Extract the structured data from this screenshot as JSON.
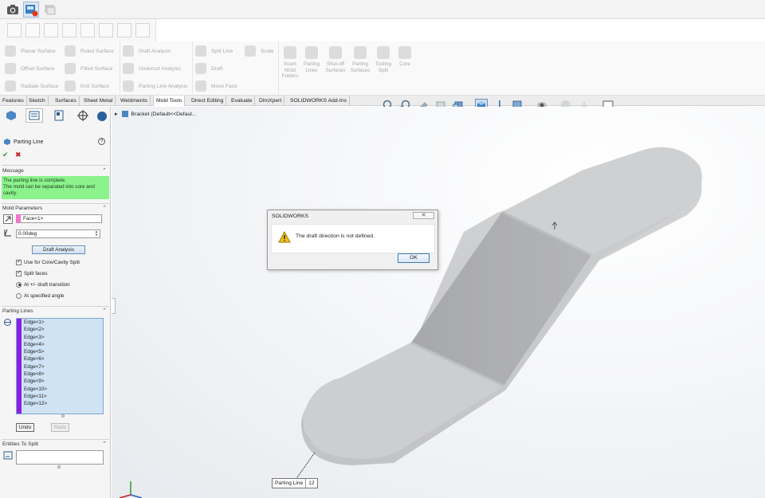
{
  "icons": {
    "top_strip": [
      "smart-dimension-icon",
      "capture-icon",
      "3d-sketch-icon"
    ],
    "sketch_row_count": 9
  },
  "ribbon": {
    "surface_tools": [
      {
        "label": "Planar Surface",
        "icon": "planar-surface-icon"
      },
      {
        "label": "Offset Surface",
        "icon": "offset-surface-icon"
      },
      {
        "label": "Radiate Surface",
        "icon": "radiate-surface-icon"
      },
      {
        "label": "Ruled Surface",
        "icon": "ruled-surface-icon"
      },
      {
        "label": "Filled Surface",
        "icon": "filled-surface-icon"
      },
      {
        "label": "Knit Surface",
        "icon": "knit-surface-icon"
      }
    ],
    "analysis_tools": [
      {
        "label": "Draft Analysis",
        "icon": "draft-analysis-icon"
      },
      {
        "label": "Undercut Analysis",
        "icon": "undercut-analysis-icon"
      },
      {
        "label": "Parting Line Analysis",
        "icon": "parting-line-analysis-icon"
      }
    ],
    "face_tools": [
      {
        "label": "Split Line",
        "icon": "split-line-icon"
      },
      {
        "label": "Draft",
        "icon": "draft-icon"
      },
      {
        "label": "Move Face",
        "icon": "move-face-icon"
      },
      {
        "label": "Scale",
        "icon": "scale-icon"
      }
    ],
    "big_tools": [
      {
        "label": "Insert Mold Folders",
        "icon": "insert-mold-folders-icon"
      },
      {
        "label": "Parting Lines",
        "icon": "parting-lines-icon"
      },
      {
        "label": "Shut-off Surfaces",
        "icon": "shut-off-surfaces-icon"
      },
      {
        "label": "Parting Surfaces",
        "icon": "parting-surfaces-icon"
      },
      {
        "label": "Tooling Split",
        "icon": "tooling-split-icon"
      },
      {
        "label": "Core",
        "icon": "core-icon"
      }
    ]
  },
  "tabs": [
    "Features",
    "Sketch",
    "Surfaces",
    "Sheet Metal",
    "Weldments",
    "Mold Tools",
    "Direct Editing",
    "Evaluate",
    "DimXpert",
    "SOLIDWORKS Add-Ins"
  ],
  "active_tab": "Mold Tools",
  "property_manager": {
    "title": "Parting Line",
    "message_section": "Message",
    "message_lines": [
      "The parting line is complete.",
      "The mold can be separated into core and",
      "cavity."
    ],
    "mold_params_section": "Mold Parameters",
    "direction_value": "Face<1>",
    "angle_value": "0.00deg",
    "draft_analysis_button": "Draft Analysis",
    "use_core_cavity": "Use for Core/Cavity Split",
    "split_faces": "Split faces",
    "at_transition": "At +/- draft transition",
    "at_angle": "At specified angle",
    "parting_lines_section": "Parting Lines",
    "edges": [
      "Edge<1>",
      "Edge<2>",
      "Edge<3>",
      "Edge<4>",
      "Edge<5>",
      "Edge<6>",
      "Edge<7>",
      "Edge<8>",
      "Edge<9>",
      "Edge<10>",
      "Edge<11>",
      "Edge<12>"
    ],
    "undo_button": "Undo",
    "redo_button": "Redo",
    "entities_section": "Entities To Split"
  },
  "viewport": {
    "tree_item": "Bracket  (Default<<Defaul..."
  },
  "dialog": {
    "title": "SOLIDWORKS",
    "close_glyph": "✕",
    "message": "The draft direction is not defined.",
    "ok_button": "OK"
  },
  "callout": {
    "label": "Parting Line",
    "value": "12"
  },
  "colors": {
    "accent_purple": "#8a1fe0",
    "message_green": "#8cf28c",
    "selection_blue": "#cfe3f5"
  }
}
